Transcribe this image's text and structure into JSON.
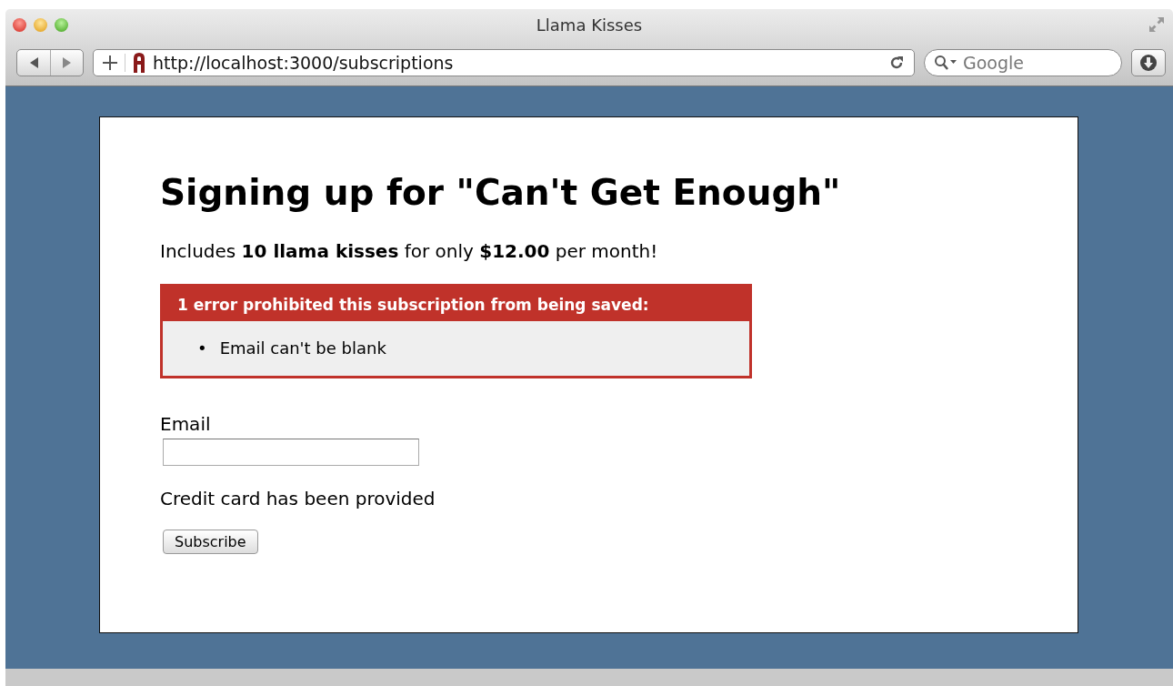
{
  "window": {
    "title": "Llama Kisses"
  },
  "toolbar": {
    "address": "http://localhost:3000/subscriptions",
    "search_placeholder": "Google"
  },
  "page": {
    "heading": "Signing up for \"Can't Get Enough\"",
    "intro": "Includes **10 llama kisses** for only **$12.00** per month!",
    "error_box": {
      "title": "1 error prohibited this subscription from being saved:",
      "messages": [
        {
          "bullet": "•",
          "text": "Email can't be blank"
        }
      ]
    },
    "form": {
      "email_label": "Email",
      "card_note": "Credit card has been provided",
      "submit": "Subscribe"
    }
  }
}
